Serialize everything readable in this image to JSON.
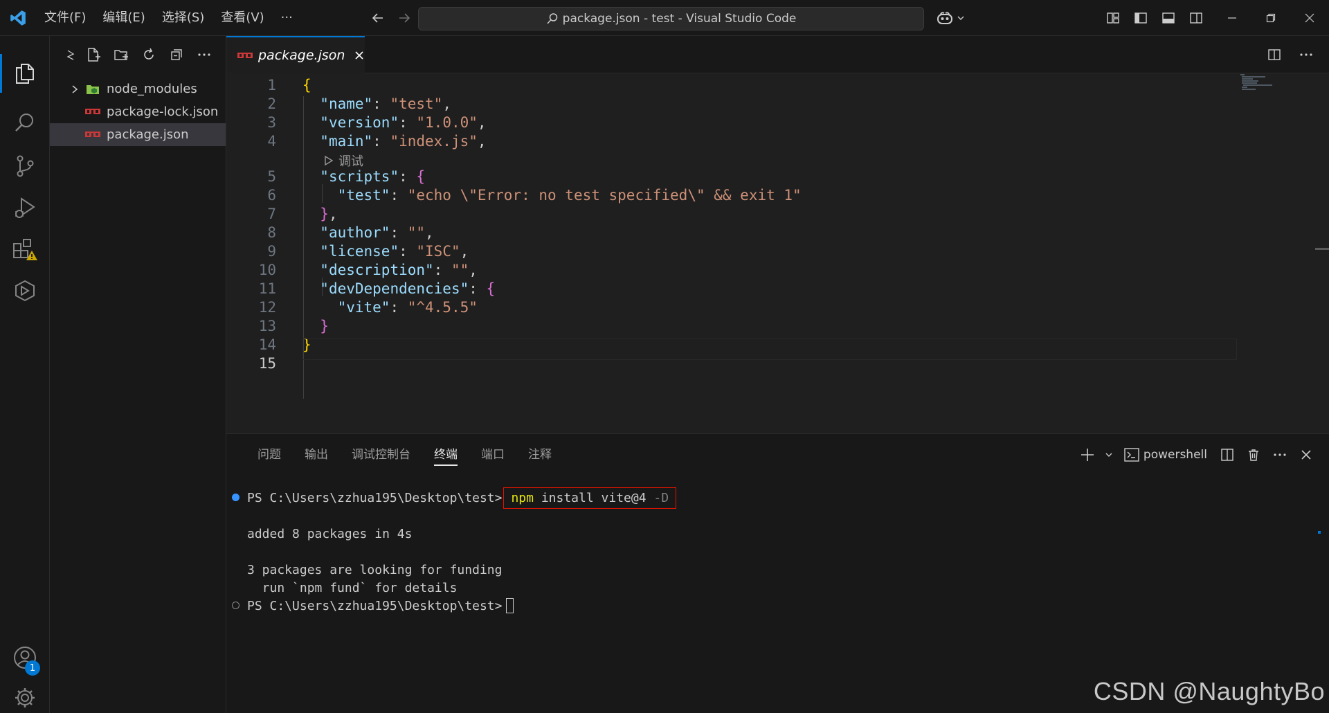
{
  "titlebar": {
    "menu": [
      "文件(F)",
      "编辑(E)",
      "选择(S)",
      "查看(V)",
      "···"
    ],
    "search_text": "package.json - test - Visual Studio Code"
  },
  "activity_bar": {
    "items": [
      "explorer-icon",
      "search-icon",
      "source-control-icon",
      "run-debug-icon",
      "extensions-icon",
      "remote-explorer-icon"
    ],
    "accounts_badge": "1"
  },
  "explorer": {
    "files": [
      {
        "name": "node_modules",
        "type": "folder"
      },
      {
        "name": "package-lock.json",
        "type": "json"
      },
      {
        "name": "package.json",
        "type": "json",
        "selected": true
      }
    ]
  },
  "editor": {
    "tab_label": "package.json",
    "codelens": "调试",
    "line_numbers": [
      "1",
      "2",
      "3",
      "4",
      "5",
      "6",
      "7",
      "8",
      "9",
      "10",
      "11",
      "12",
      "13",
      "14",
      "15"
    ]
  },
  "panel": {
    "tabs": [
      "问题",
      "输出",
      "调试控制台",
      "终端",
      "端口",
      "注释"
    ],
    "active_tab": "终端",
    "shell_label": "powershell"
  },
  "terminal": {
    "prompt": "PS C:\\Users\\zzhua195\\Desktop\\test>",
    "cmd_npm": "npm",
    "cmd_rest": " install vite@4 ",
    "cmd_flag": "-D",
    "out1": "added 8 packages in 4s",
    "out2": "3 packages are looking for funding",
    "out3": "  run `npm fund` for details"
  },
  "watermark": "CSDN @NaughtyBo",
  "colors": {
    "accent": "#0078d4",
    "command_box": "#e51400",
    "string": "#ce9178",
    "key": "#9cdcfe"
  }
}
